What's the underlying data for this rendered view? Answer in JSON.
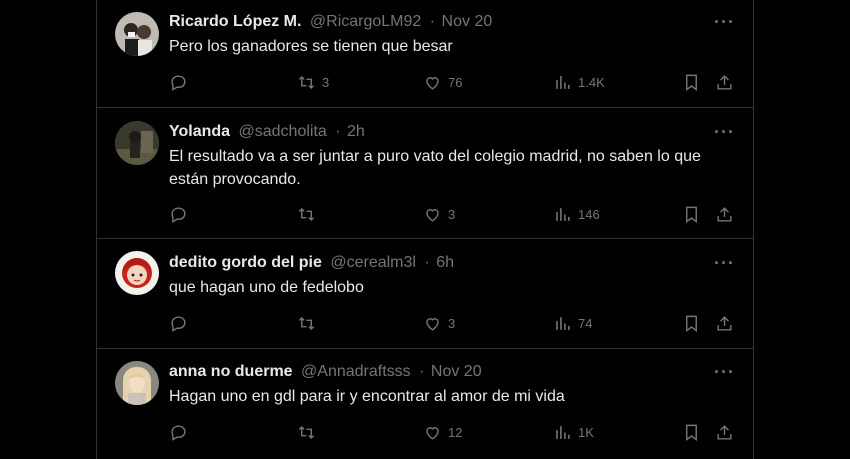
{
  "tweets": [
    {
      "name": "Ricardo López M.",
      "handle": "@RicargoLM92",
      "time": "Nov 20",
      "text": "Pero los ganadores se tienen que besar",
      "replies": "",
      "retweets": "3",
      "likes": "76",
      "views": "1.4K"
    },
    {
      "name": "Yolanda",
      "handle": "@sadcholita",
      "time": "2h",
      "text": "El resultado va a ser juntar a puro vato del colegio madrid, no saben lo que están provocando.",
      "replies": "",
      "retweets": "",
      "likes": "3",
      "views": "146"
    },
    {
      "name": "dedito gordo del pie",
      "handle": "@cerealm3l",
      "time": "6h",
      "text": "que hagan uno de fedelobo",
      "replies": "",
      "retweets": "",
      "likes": "3",
      "views": "74"
    },
    {
      "name": "anna no duerme",
      "handle": "@Annadraftsss",
      "time": "Nov 20",
      "text": "Hagan uno en gdl para ir y encontrar al amor de mi vida",
      "replies": "",
      "retweets": "",
      "likes": "12",
      "views": "1K"
    }
  ],
  "separator": "·",
  "more_glyph": "···"
}
